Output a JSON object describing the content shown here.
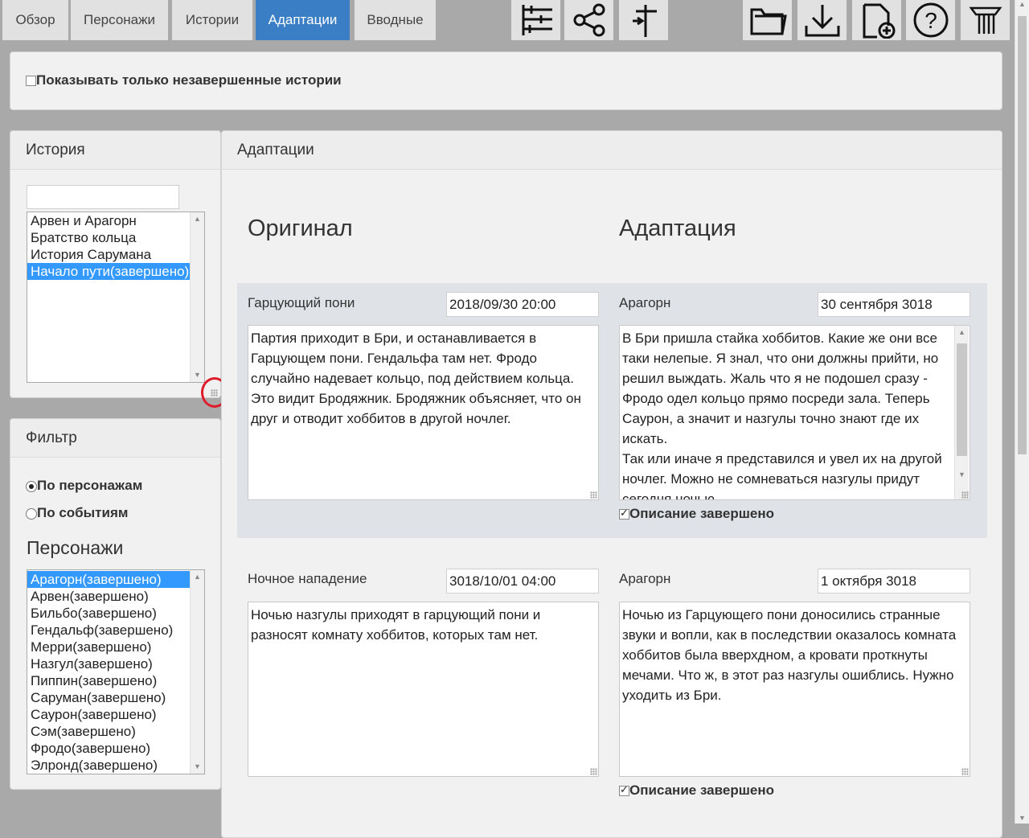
{
  "tabs": [
    {
      "label": "Обзор"
    },
    {
      "label": "Персонажи"
    },
    {
      "label": "Истории"
    },
    {
      "label": "Адаптации"
    },
    {
      "label": "Вводные"
    }
  ],
  "toolbar_icons": [
    "timeline-settings-icon",
    "share-icon",
    "split-icon",
    "folder-icon",
    "download-icon",
    "new-file-icon",
    "help-icon",
    "logo-icon"
  ],
  "filter_top": {
    "checkbox_label": "Показывать только незавершенные истории",
    "checked": false
  },
  "story_panel": {
    "title": "История",
    "search_value": "",
    "items": [
      "Арвен и Арагорн",
      "Братство кольца",
      "История Сарумана",
      "Начало пути(завершено)"
    ],
    "selected_index": 3
  },
  "filter_panel": {
    "title": "Фильтр",
    "radio_characters": "По персонажам",
    "radio_events": "По событиям",
    "characters_heading": "Персонажи",
    "characters": [
      "Арагорн(завершено)",
      "Арвен(завершено)",
      "Бильбо(завершено)",
      "Гендальф(завершено)",
      "Мерри(завершено)",
      "Назгул(завершено)",
      "Пиппин(завершено)",
      "Саруман(завершено)",
      "Саурон(завершено)",
      "Сэм(завершено)",
      "Фродо(завершено)",
      "Элронд(завершено)"
    ],
    "selected_index": 0
  },
  "main": {
    "title": "Адаптации",
    "col_original": "Оригинал",
    "col_adaptation": "Адаптация",
    "events": [
      {
        "name": "Гарцующий пони",
        "time": "2018/09/30 20:00",
        "text": "Партия приходит в Бри, и останавливается в Гарцующем пони. Гендальфа там нет. Фродо случайно надевает кольцо, под действием кольца. Это видит Бродяжник. Бродяжник объясняет, что он друг и отводит хоббитов в другой ночлег.",
        "character": "Арагорн",
        "adapt_time": "30 сентября 3018",
        "adapt_text": "В Бри пришла стайка хоббитов. Какие же они все таки нелепые. Я знал, что они должны прийти, но решил выждать. Жаль что я не подошел сразу - Фродо одел кольцо прямо посреди зала. Теперь Саурон, а значит и назгулы точно знают где их искать.\nТак или иначе я представился и увел их на другой ночлег. Можно не сомневаться назгулы придут сегодня ночью.",
        "done_label": "Описание завершено",
        "done": true
      },
      {
        "name": "Ночное нападение",
        "time": "3018/10/01 04:00",
        "text": "Ночью назгулы приходят в гарцующий пони и разносят комнату хоббитов, которых там нет.",
        "character": "Арагорн",
        "adapt_time": "1 октября 3018",
        "adapt_text": "Ночью из Гарцующего пони доносились странные звуки и вопли, как в последствии оказалось комната хоббитов была вверхдном, а кровати проткнуты мечами. Что ж, в этот раз назгулы ошиблись. Нужно уходить из Бри.",
        "done_label": "Описание завершено",
        "done": true
      }
    ]
  }
}
